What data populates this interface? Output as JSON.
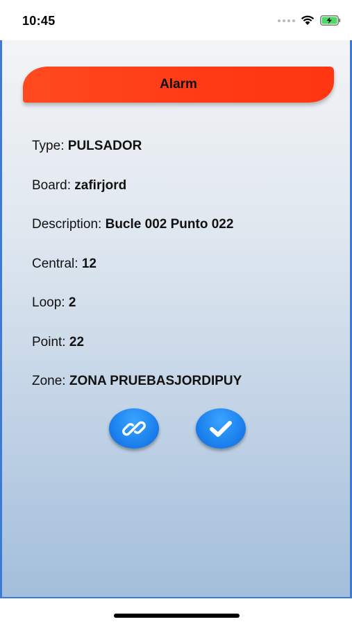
{
  "status_bar": {
    "time": "10:45",
    "icons": [
      "cellular-dots-icon",
      "wifi-icon",
      "battery-charging-icon"
    ],
    "battery_color": "#4cd964"
  },
  "header": {
    "title": "Alarm",
    "color": "#ff3a14"
  },
  "fields": {
    "type": {
      "label": "Type:",
      "value": "PULSADOR"
    },
    "board": {
      "label": "Board:",
      "value": "zafirjord"
    },
    "description": {
      "label": "Description:",
      "value": "Bucle 002 Punto 022"
    },
    "central": {
      "label": "Central:",
      "value": "12"
    },
    "loop": {
      "label": "Loop:",
      "value": "2"
    },
    "point": {
      "label": "Point:",
      "value": "22"
    },
    "zone": {
      "label": "Zone:",
      "value": "ZONA PRUEBASJORDIPUY"
    }
  },
  "actions": {
    "link_icon": "link-icon",
    "check_icon": "checkmark-icon",
    "button_color": "#1f85f0"
  }
}
